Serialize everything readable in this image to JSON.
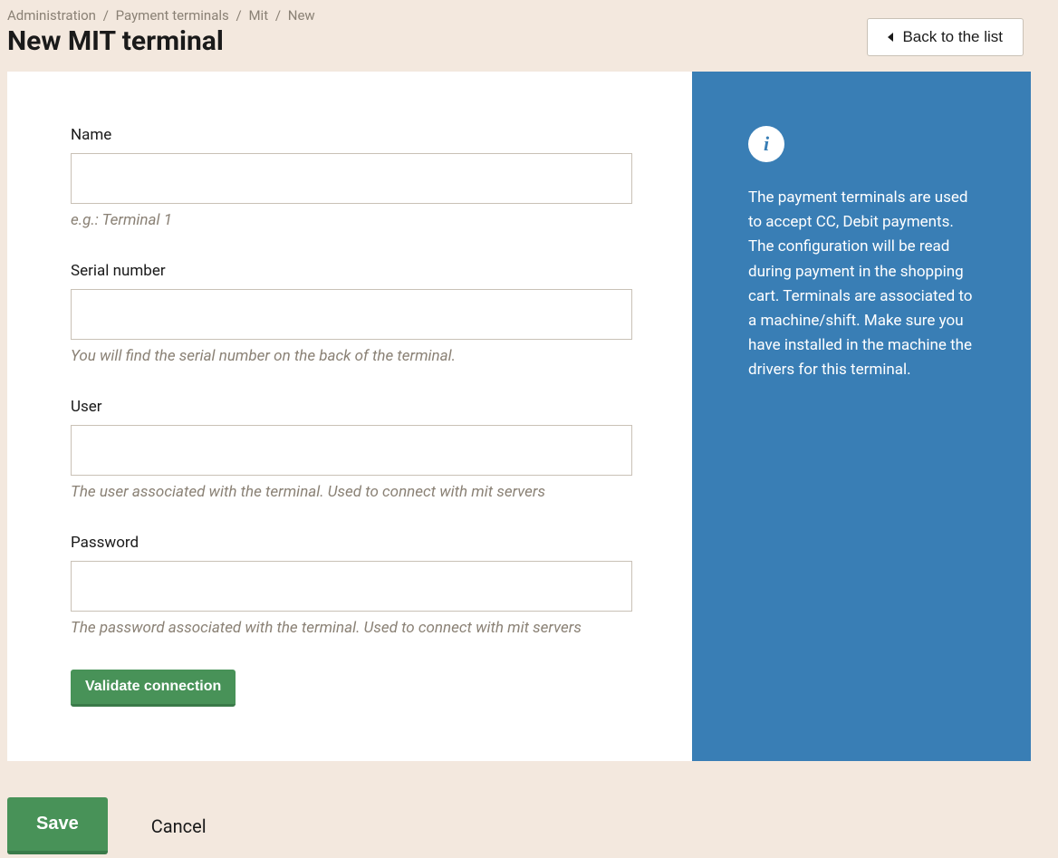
{
  "breadcrumb": [
    "Administration",
    "Payment terminals",
    "Mit",
    "New"
  ],
  "page_title": "New MIT terminal",
  "back_label": "Back to the list",
  "form": {
    "name": {
      "label": "Name",
      "value": "",
      "hint": "e.g.: Terminal 1"
    },
    "serial": {
      "label": "Serial number",
      "value": "",
      "hint": "You will find the serial number on the back of the terminal."
    },
    "user": {
      "label": "User",
      "value": "",
      "hint": "The user associated with the terminal. Used to connect with mit servers"
    },
    "password": {
      "label": "Password",
      "value": "",
      "hint": "The password associated with the terminal. Used to connect with mit servers"
    },
    "validate_label": "Validate connection"
  },
  "info": {
    "text": "The payment terminals are used to accept CC, Debit payments. The configuration will be read during payment in the shopping cart. Terminals are associated to a machine/shift. Make sure you have installed in the machine the drivers for this terminal."
  },
  "actions": {
    "save_label": "Save",
    "cancel_label": "Cancel"
  }
}
